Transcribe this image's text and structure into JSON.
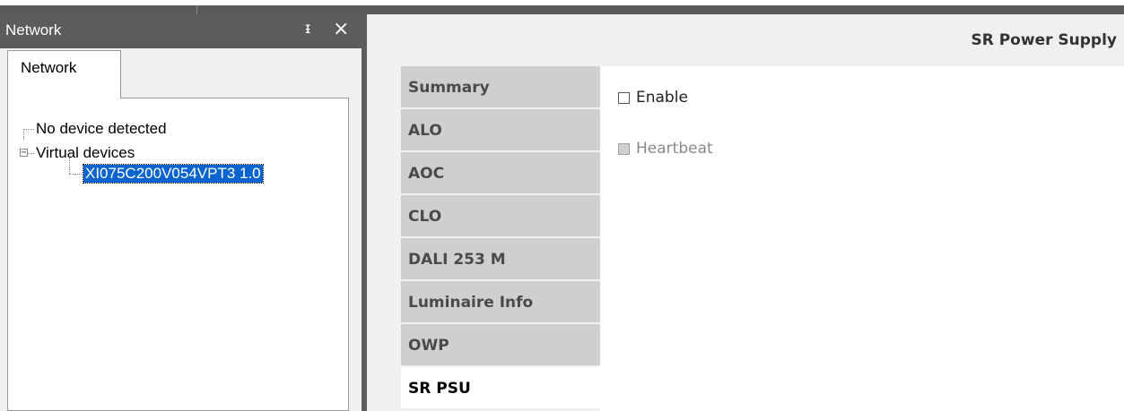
{
  "network_pane": {
    "title": "Network",
    "tab_label": "Network",
    "tree": {
      "no_device": "No device detected",
      "virtual_devices": "Virtual devices",
      "virtual_expander": "−",
      "device": "XI075C200V054VPT3 1.0"
    }
  },
  "content": {
    "title": "SR Power Supply",
    "tabs": [
      {
        "label": "Summary"
      },
      {
        "label": "ALO"
      },
      {
        "label": "AOC"
      },
      {
        "label": "CLO"
      },
      {
        "label": "DALI 253 M"
      },
      {
        "label": "Luminaire Info"
      },
      {
        "label": "OWP"
      },
      {
        "label": "SR PSU"
      }
    ],
    "active_tab": "SR PSU",
    "options": {
      "enable_label": "Enable",
      "enable_checked": false,
      "heartbeat_label": "Heartbeat",
      "heartbeat_enabled": false
    }
  },
  "icons": {
    "pin": "pin-icon",
    "close": "close-icon"
  },
  "colors": {
    "header_bg": "#5c5c5c",
    "selection": "#0a64d0",
    "tab_bg": "#cfcfcf"
  }
}
